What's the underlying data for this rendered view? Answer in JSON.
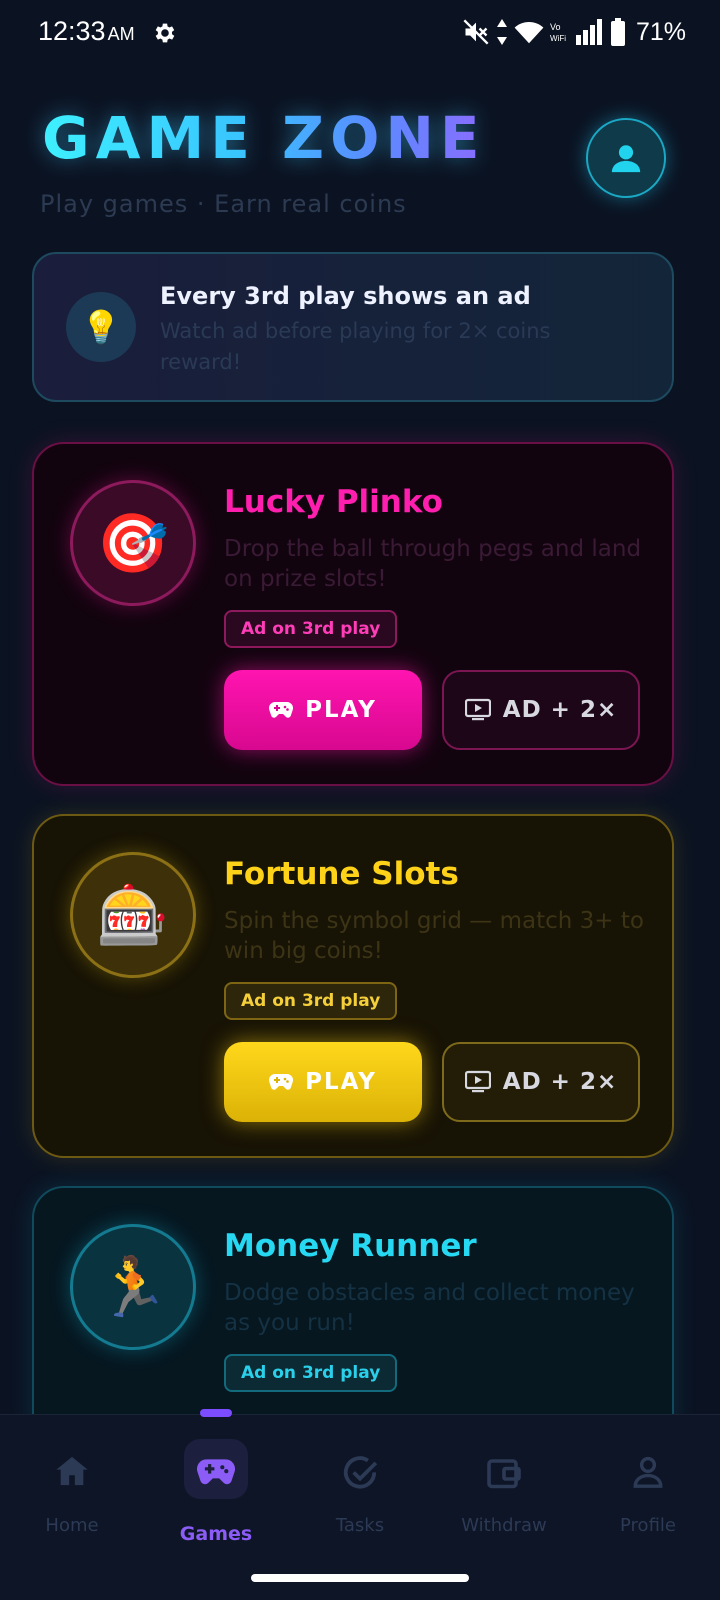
{
  "status_bar": {
    "time": "12:33",
    "ampm": "AM",
    "battery": "71%",
    "icons": [
      "settings-icon",
      "mute-icon",
      "data-arrows-icon",
      "wifi-icon",
      "vowifi-icon",
      "signal-icon",
      "battery-icon"
    ]
  },
  "header": {
    "title": "GAME ZONE",
    "subtitle": "Play games · Earn real coins"
  },
  "info": {
    "icon": "💡",
    "title": "Every 3rd play shows an ad",
    "description": "Watch ad before playing for 2× coins reward!"
  },
  "games": [
    {
      "icon": "🎯",
      "title": "Lucky Plinko",
      "description": "Drop the ball through pegs and land on prize slots!",
      "badge": "Ad on 3rd play",
      "play_label": "PLAY",
      "ad_label": "AD + 2×",
      "accent": "#ff1fae"
    },
    {
      "icon": "🎰",
      "title": "Fortune Slots",
      "description": "Spin the symbol grid — match 3+ to win big coins!",
      "badge": "Ad on 3rd play",
      "play_label": "PLAY",
      "ad_label": "AD + 2×",
      "accent": "#ffd21a"
    },
    {
      "icon": "🏃",
      "title": "Money Runner",
      "description": "Dodge obstacles and collect money as you run!",
      "badge": "Ad on 3rd play",
      "accent": "#26d8f2"
    }
  ],
  "nav": {
    "items": [
      {
        "label": "Home",
        "icon": "home-icon"
      },
      {
        "label": "Games",
        "icon": "gamepad-icon",
        "active": true
      },
      {
        "label": "Tasks",
        "icon": "check-circle-icon"
      },
      {
        "label": "Withdraw",
        "icon": "wallet-icon"
      },
      {
        "label": "Profile",
        "icon": "user-icon"
      }
    ]
  }
}
